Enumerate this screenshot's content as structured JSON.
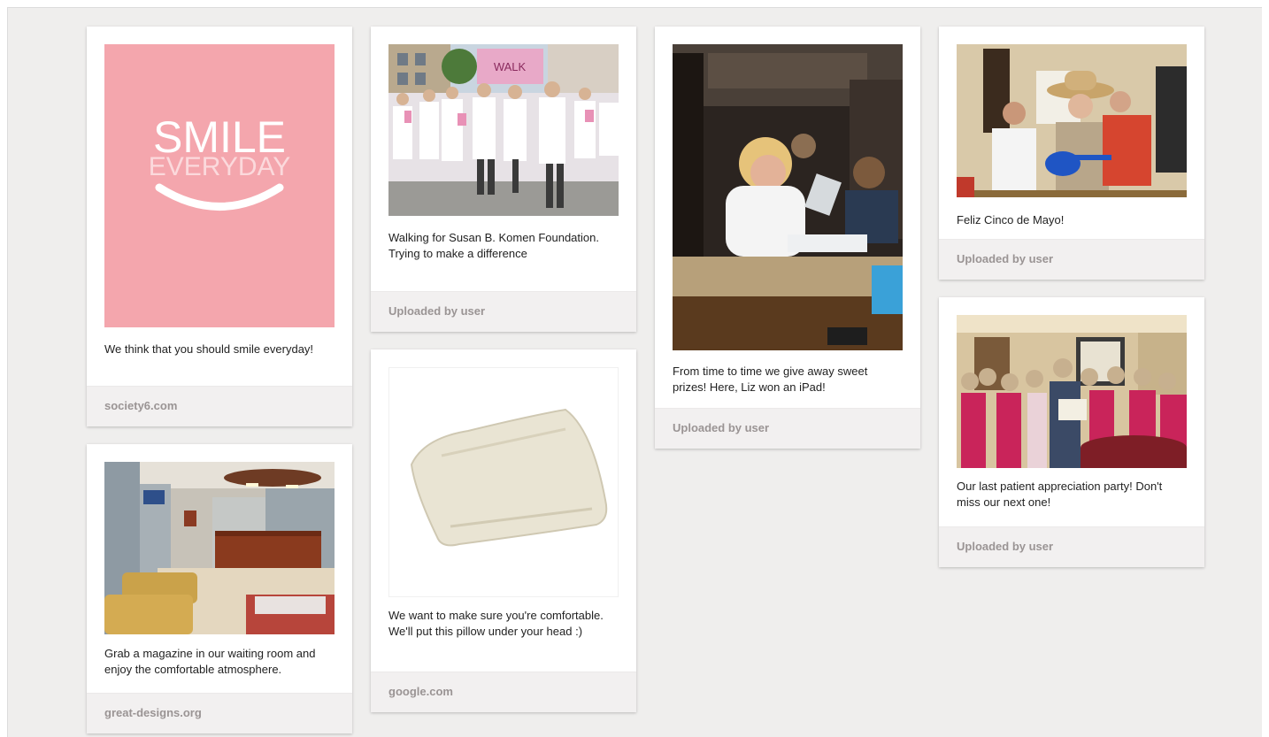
{
  "pins": [
    {
      "id": "smile",
      "image_text_big": "SMILE",
      "image_text_small": "EVERYDAY",
      "description": "We think that you should smile everyday!",
      "source": "society6.com"
    },
    {
      "id": "lobby",
      "description": "Grab a magazine in our waiting room and enjoy the comfortable atmosphere.",
      "source": "great-designs.org"
    },
    {
      "id": "walk",
      "sign_text": "WALK",
      "description": "Walking for Susan B. Komen Foundation. Trying to make a difference",
      "source": "Uploaded by user"
    },
    {
      "id": "pillow",
      "description": "We want to make sure you're comfortable. We'll put this pillow under your head :)",
      "source": "google.com"
    },
    {
      "id": "ipad",
      "description": "From time to time we give away sweet prizes! Here, Liz won an iPad!",
      "source": "Uploaded by user"
    },
    {
      "id": "cinco",
      "description": "Feliz Cinco de Mayo!",
      "source": "Uploaded by user"
    },
    {
      "id": "party",
      "description": "Our last patient appreciation party! Don't miss our next one!",
      "source": "Uploaded by user"
    }
  ],
  "colors": {
    "board_bg": "#efeeed",
    "card_bg": "#ffffff",
    "source_bar": "#f2f0f0",
    "source_text": "#9a9494",
    "smile_pink": "#f4a6ad"
  }
}
